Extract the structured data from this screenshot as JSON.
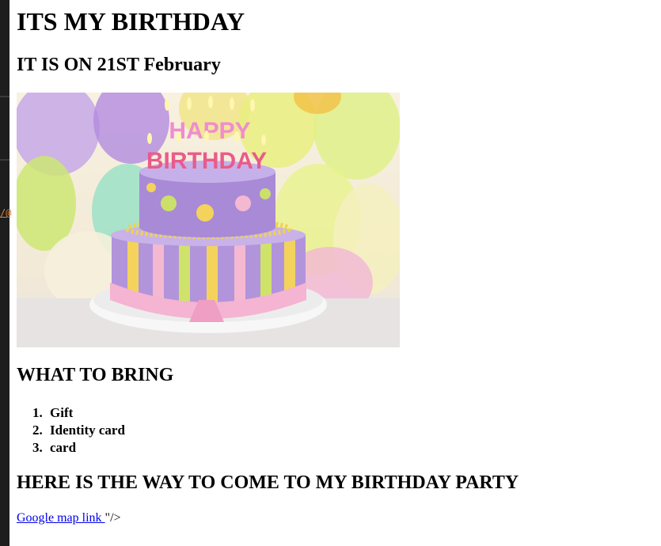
{
  "editor_edge": {
    "fragment": "/@"
  },
  "page": {
    "title": "ITS MY BIRTHDAY",
    "date_heading": "IT IS ON 21ST February",
    "cake_image": {
      "lettering_top": "HAPPY",
      "lettering_bottom": "BIRTHDAY"
    },
    "bring_heading": "WHAT TO BRING",
    "bring_items": [
      {
        "num": "1.",
        "label": "Gift"
      },
      {
        "num": "2.",
        "label": "Identity card"
      },
      {
        "num": "3.",
        "label": "card"
      }
    ],
    "way_heading": "HERE IS THE WAY TO COME TO MY BIRTHDAY PARTY",
    "map_link": {
      "label": "Google map link ",
      "trailing": "\"/>"
    }
  }
}
